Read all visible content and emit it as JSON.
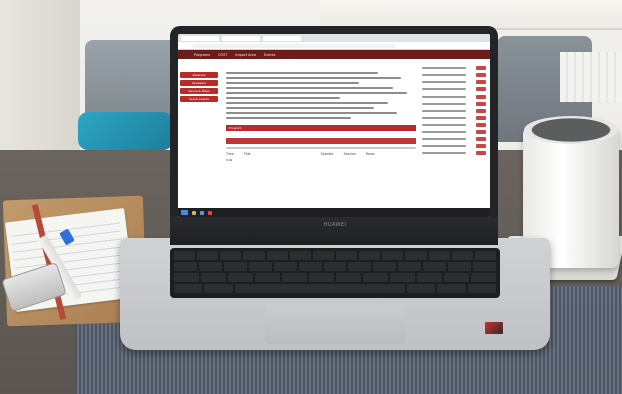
{
  "scene": {
    "laptop_brand": "HUAWEI"
  },
  "screen": {
    "tabs": [
      "",
      "",
      ""
    ],
    "url": "",
    "site_nav": [
      "",
      "Programs",
      "COST",
      "Impact Area",
      "Events"
    ],
    "sidebar_buttons": [
      "Sessions",
      "Speakers",
      "Venue & Maps",
      "Social events"
    ],
    "section_header": "Program",
    "progress_label": "",
    "subtabs": [
      "",
      "",
      "",
      "",
      ""
    ],
    "table": {
      "headers": [
        "Time",
        "Title",
        "Speaker",
        "Session",
        "Room"
      ],
      "row": [
        "9:00",
        "",
        "",
        "",
        ""
      ]
    },
    "right_heading_1": "",
    "right_heading_2": "",
    "clock": ""
  }
}
